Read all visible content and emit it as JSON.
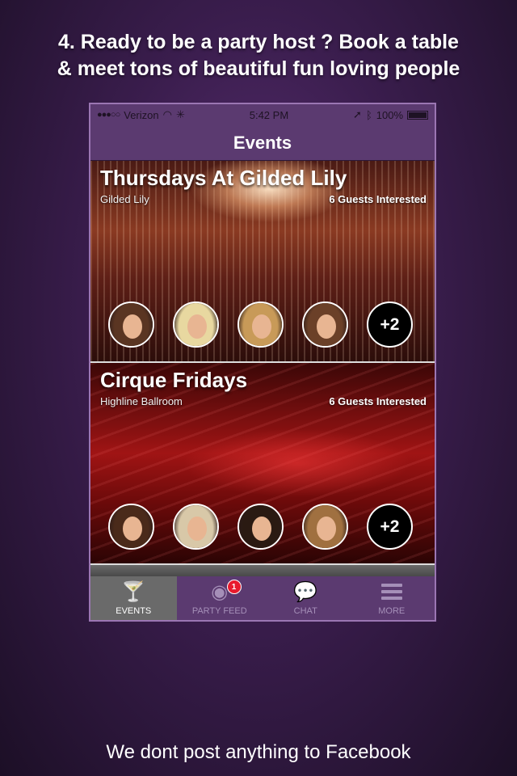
{
  "promo": {
    "headline_line1": "4.  Ready to be a party host ?  Book a table",
    "headline_line2": "& meet tons  of  beautiful fun loving people",
    "footer": "We dont post anything to Facebook"
  },
  "status_bar": {
    "carrier": "Verizon",
    "time": "5:42 PM",
    "battery": "100%"
  },
  "nav": {
    "title": "Events"
  },
  "events": [
    {
      "title": "Thursdays At Gilded Lily",
      "venue": "Gilded Lily",
      "guests": "6 Guests Interested",
      "more": "+2",
      "avatar_hair_colors": [
        "#5a3522",
        "#e8d8a0",
        "#c89a58",
        "#6b4028"
      ]
    },
    {
      "title": "Cirque Fridays",
      "venue": "Highline Ballroom",
      "guests": "6 Guests Interested",
      "more": "+2",
      "avatar_hair_colors": [
        "#4a2a1a",
        "#d8c8a8",
        "#2a1a12",
        "#a07040"
      ]
    }
  ],
  "tabs": [
    {
      "label": "EVENTS",
      "icon": "cocktail-glasses-icon",
      "active": true
    },
    {
      "label": "PARTY FEED",
      "icon": "eye-icon",
      "badge": "1"
    },
    {
      "label": "CHAT",
      "icon": "chat-bubble-icon"
    },
    {
      "label": "MORE",
      "icon": "menu-icon"
    }
  ],
  "colors": {
    "nav_purple": "#5b3a70",
    "badge_red": "#e81b2e",
    "active_tab": "#6a6a6a"
  }
}
